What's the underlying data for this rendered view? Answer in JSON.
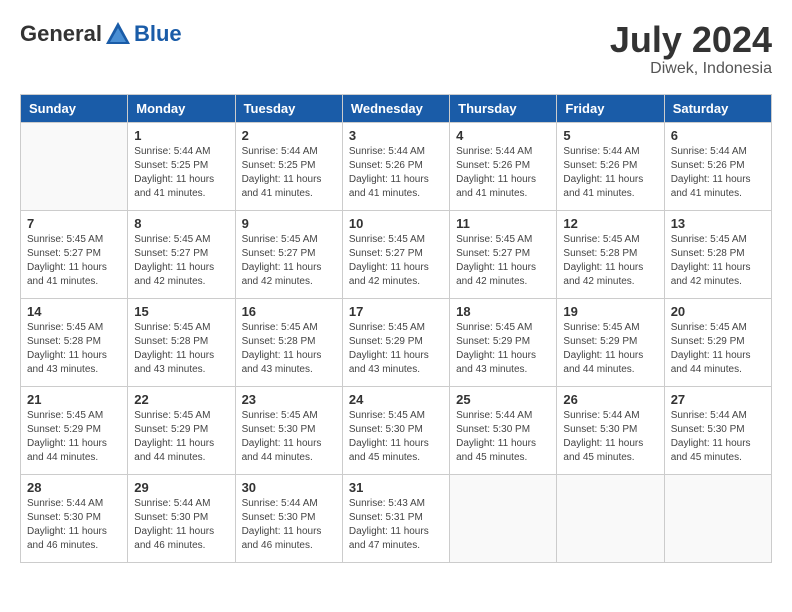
{
  "header": {
    "logo_general": "General",
    "logo_blue": "Blue",
    "month_year": "July 2024",
    "location": "Diwek, Indonesia"
  },
  "days_of_week": [
    "Sunday",
    "Monday",
    "Tuesday",
    "Wednesday",
    "Thursday",
    "Friday",
    "Saturday"
  ],
  "weeks": [
    [
      {
        "day": "",
        "info": ""
      },
      {
        "day": "1",
        "info": "Sunrise: 5:44 AM\nSunset: 5:25 PM\nDaylight: 11 hours\nand 41 minutes."
      },
      {
        "day": "2",
        "info": "Sunrise: 5:44 AM\nSunset: 5:25 PM\nDaylight: 11 hours\nand 41 minutes."
      },
      {
        "day": "3",
        "info": "Sunrise: 5:44 AM\nSunset: 5:26 PM\nDaylight: 11 hours\nand 41 minutes."
      },
      {
        "day": "4",
        "info": "Sunrise: 5:44 AM\nSunset: 5:26 PM\nDaylight: 11 hours\nand 41 minutes."
      },
      {
        "day": "5",
        "info": "Sunrise: 5:44 AM\nSunset: 5:26 PM\nDaylight: 11 hours\nand 41 minutes."
      },
      {
        "day": "6",
        "info": "Sunrise: 5:44 AM\nSunset: 5:26 PM\nDaylight: 11 hours\nand 41 minutes."
      }
    ],
    [
      {
        "day": "7",
        "info": "Sunrise: 5:45 AM\nSunset: 5:27 PM\nDaylight: 11 hours\nand 41 minutes."
      },
      {
        "day": "8",
        "info": "Sunrise: 5:45 AM\nSunset: 5:27 PM\nDaylight: 11 hours\nand 42 minutes."
      },
      {
        "day": "9",
        "info": "Sunrise: 5:45 AM\nSunset: 5:27 PM\nDaylight: 11 hours\nand 42 minutes."
      },
      {
        "day": "10",
        "info": "Sunrise: 5:45 AM\nSunset: 5:27 PM\nDaylight: 11 hours\nand 42 minutes."
      },
      {
        "day": "11",
        "info": "Sunrise: 5:45 AM\nSunset: 5:27 PM\nDaylight: 11 hours\nand 42 minutes."
      },
      {
        "day": "12",
        "info": "Sunrise: 5:45 AM\nSunset: 5:28 PM\nDaylight: 11 hours\nand 42 minutes."
      },
      {
        "day": "13",
        "info": "Sunrise: 5:45 AM\nSunset: 5:28 PM\nDaylight: 11 hours\nand 42 minutes."
      }
    ],
    [
      {
        "day": "14",
        "info": "Sunrise: 5:45 AM\nSunset: 5:28 PM\nDaylight: 11 hours\nand 43 minutes."
      },
      {
        "day": "15",
        "info": "Sunrise: 5:45 AM\nSunset: 5:28 PM\nDaylight: 11 hours\nand 43 minutes."
      },
      {
        "day": "16",
        "info": "Sunrise: 5:45 AM\nSunset: 5:28 PM\nDaylight: 11 hours\nand 43 minutes."
      },
      {
        "day": "17",
        "info": "Sunrise: 5:45 AM\nSunset: 5:29 PM\nDaylight: 11 hours\nand 43 minutes."
      },
      {
        "day": "18",
        "info": "Sunrise: 5:45 AM\nSunset: 5:29 PM\nDaylight: 11 hours\nand 43 minutes."
      },
      {
        "day": "19",
        "info": "Sunrise: 5:45 AM\nSunset: 5:29 PM\nDaylight: 11 hours\nand 44 minutes."
      },
      {
        "day": "20",
        "info": "Sunrise: 5:45 AM\nSunset: 5:29 PM\nDaylight: 11 hours\nand 44 minutes."
      }
    ],
    [
      {
        "day": "21",
        "info": "Sunrise: 5:45 AM\nSunset: 5:29 PM\nDaylight: 11 hours\nand 44 minutes."
      },
      {
        "day": "22",
        "info": "Sunrise: 5:45 AM\nSunset: 5:29 PM\nDaylight: 11 hours\nand 44 minutes."
      },
      {
        "day": "23",
        "info": "Sunrise: 5:45 AM\nSunset: 5:30 PM\nDaylight: 11 hours\nand 44 minutes."
      },
      {
        "day": "24",
        "info": "Sunrise: 5:45 AM\nSunset: 5:30 PM\nDaylight: 11 hours\nand 45 minutes."
      },
      {
        "day": "25",
        "info": "Sunrise: 5:44 AM\nSunset: 5:30 PM\nDaylight: 11 hours\nand 45 minutes."
      },
      {
        "day": "26",
        "info": "Sunrise: 5:44 AM\nSunset: 5:30 PM\nDaylight: 11 hours\nand 45 minutes."
      },
      {
        "day": "27",
        "info": "Sunrise: 5:44 AM\nSunset: 5:30 PM\nDaylight: 11 hours\nand 45 minutes."
      }
    ],
    [
      {
        "day": "28",
        "info": "Sunrise: 5:44 AM\nSunset: 5:30 PM\nDaylight: 11 hours\nand 46 minutes."
      },
      {
        "day": "29",
        "info": "Sunrise: 5:44 AM\nSunset: 5:30 PM\nDaylight: 11 hours\nand 46 minutes."
      },
      {
        "day": "30",
        "info": "Sunrise: 5:44 AM\nSunset: 5:30 PM\nDaylight: 11 hours\nand 46 minutes."
      },
      {
        "day": "31",
        "info": "Sunrise: 5:43 AM\nSunset: 5:31 PM\nDaylight: 11 hours\nand 47 minutes."
      },
      {
        "day": "",
        "info": ""
      },
      {
        "day": "",
        "info": ""
      },
      {
        "day": "",
        "info": ""
      }
    ]
  ]
}
